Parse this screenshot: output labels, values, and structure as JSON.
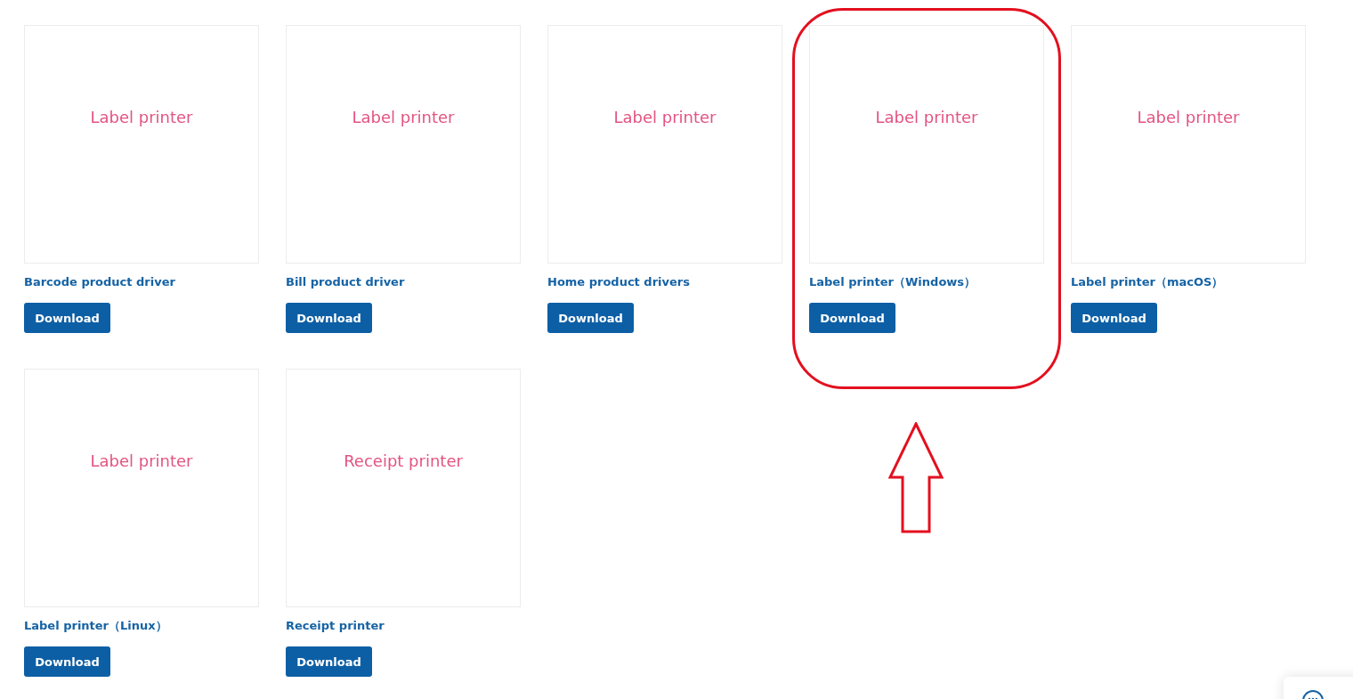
{
  "drivers": [
    {
      "image_label": "Label printer",
      "title": "Barcode product driver",
      "button": "Download",
      "highlighted": false
    },
    {
      "image_label": "Label printer",
      "title": "Bill product driver",
      "button": "Download",
      "highlighted": false
    },
    {
      "image_label": "Label printer",
      "title": "Home product drivers",
      "button": "Download",
      "highlighted": false
    },
    {
      "image_label": "Label printer",
      "title": "Label printer（Windows）",
      "button": "Download",
      "highlighted": true
    },
    {
      "image_label": "Label printer",
      "title": "Label printer（macOS）",
      "button": "Download",
      "highlighted": false
    },
    {
      "image_label": "Label printer",
      "title": "Label printer（Linux）",
      "button": "Download",
      "highlighted": false
    },
    {
      "image_label": "Receipt printer",
      "title": "Receipt printer",
      "button": "Download",
      "highlighted": false
    }
  ],
  "chat_widget": {
    "kind": "chat"
  }
}
